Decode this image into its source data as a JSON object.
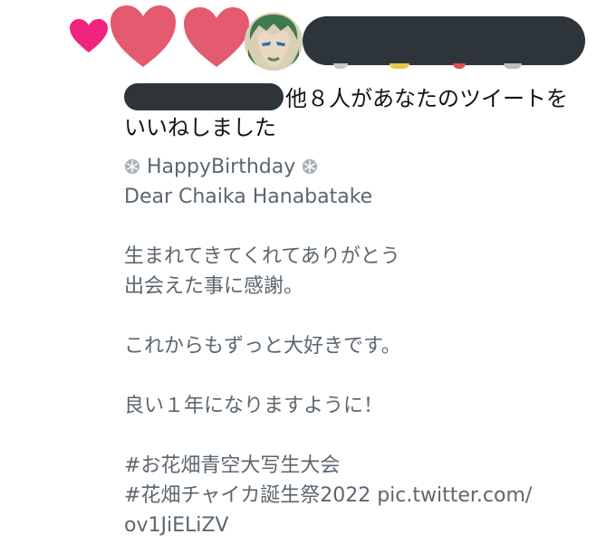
{
  "notification": {
    "suffix_line1": "他８人があなたのツイートを",
    "line2": "いいねしました"
  },
  "tweet": {
    "line1": "HappyBirthday",
    "line2": "Dear Chaika Hanabatake",
    "line3": "生まれてきてくれてありがとう",
    "line4": "出会えた事に感謝。",
    "line5": "これからもずっと大好きです。",
    "line6": "良い１年になりますように！",
    "line7": "#お花畑青空大写生大会",
    "line8": "#花畑チャイカ誕生祭2022 pic.twitter.com/",
    "line9": "ov1JiELiZV"
  },
  "icons": {
    "heart_small": "heart-icon",
    "heart_large": "heart-icon",
    "snowflake": "snowflake-icon"
  },
  "colors": {
    "heart_small": "#f0237f",
    "heart_large": "#e45a6e",
    "redaction": "#2e353a",
    "body_text": "#5b6670",
    "notice_text": "#111418"
  }
}
